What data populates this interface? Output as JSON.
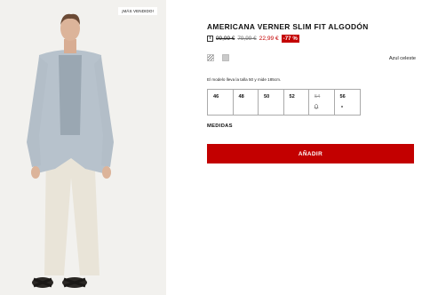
{
  "product_image": {
    "badge": "¡MÁS VENDIDO!"
  },
  "product": {
    "title": "AMERICANA VERNER SLIM FIT ALGODÓN",
    "price_original": "99,99 €",
    "price_previous": "79,99 €",
    "price_current": "22,99 €",
    "discount": "-77 %"
  },
  "colors": {
    "selected_name": "Azul celeste",
    "swatches": [
      "pattern-icon",
      "texture-icon"
    ],
    "accent": "#c30000"
  },
  "model_note": "El modelo lleva la talla 50 y mide 185cm.",
  "sizes": [
    {
      "label": "46",
      "available": true,
      "mark": ""
    },
    {
      "label": "48",
      "available": true,
      "mark": ""
    },
    {
      "label": "50",
      "available": true,
      "mark": ""
    },
    {
      "label": "52",
      "available": true,
      "mark": ""
    },
    {
      "label": "54",
      "available": false,
      "mark": "bell-icon"
    },
    {
      "label": "56",
      "available": true,
      "mark": "dot-icon"
    }
  ],
  "measures_label": "MEDIDAS",
  "add_to_cart_label": "AÑADIR"
}
